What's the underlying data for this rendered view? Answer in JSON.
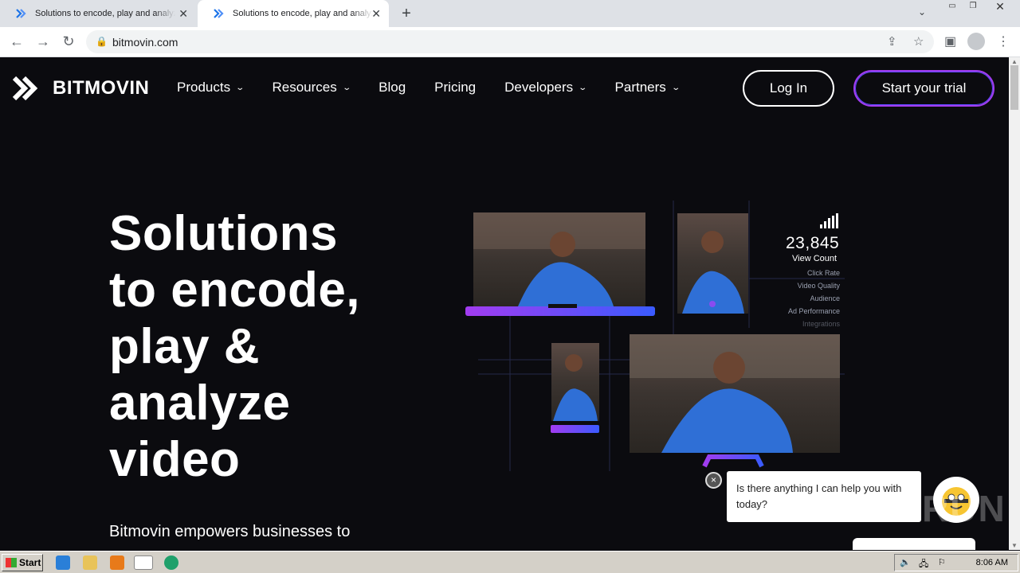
{
  "browser": {
    "tabs": [
      {
        "title": "Solutions to encode, play and analyze video"
      },
      {
        "title": "Solutions to encode, play and analyze video"
      }
    ],
    "new_tab": "+",
    "url": "bitmovin.com"
  },
  "site": {
    "logo": "BITMOVIN",
    "nav": [
      {
        "label": "Products",
        "dropdown": true
      },
      {
        "label": "Resources",
        "dropdown": true
      },
      {
        "label": "Blog",
        "dropdown": false
      },
      {
        "label": "Pricing",
        "dropdown": false
      },
      {
        "label": "Developers",
        "dropdown": true
      },
      {
        "label": "Partners",
        "dropdown": true
      }
    ],
    "login": "Log In",
    "trial": "Start your trial"
  },
  "hero": {
    "title_lines": [
      "Solutions",
      "to encode,",
      "play &",
      "analyze",
      "video"
    ],
    "subtitle": "Bitmovin empowers businesses to"
  },
  "stats": {
    "count": "23,845",
    "count_label": "View Count",
    "metrics": [
      "Click Rate",
      "Video Quality",
      "Audience",
      "Ad Performance",
      "Integrations"
    ]
  },
  "chat": {
    "message": "Is there anything I can help you with today?",
    "close": "×"
  },
  "watermark": "ANY RUN",
  "taskbar": {
    "start": "Start",
    "clock": "8:06 AM"
  },
  "colors": {
    "accent_purple": "#a23cf0",
    "accent_blue": "#3a5bff",
    "page_bg": "#0b0b0f"
  }
}
